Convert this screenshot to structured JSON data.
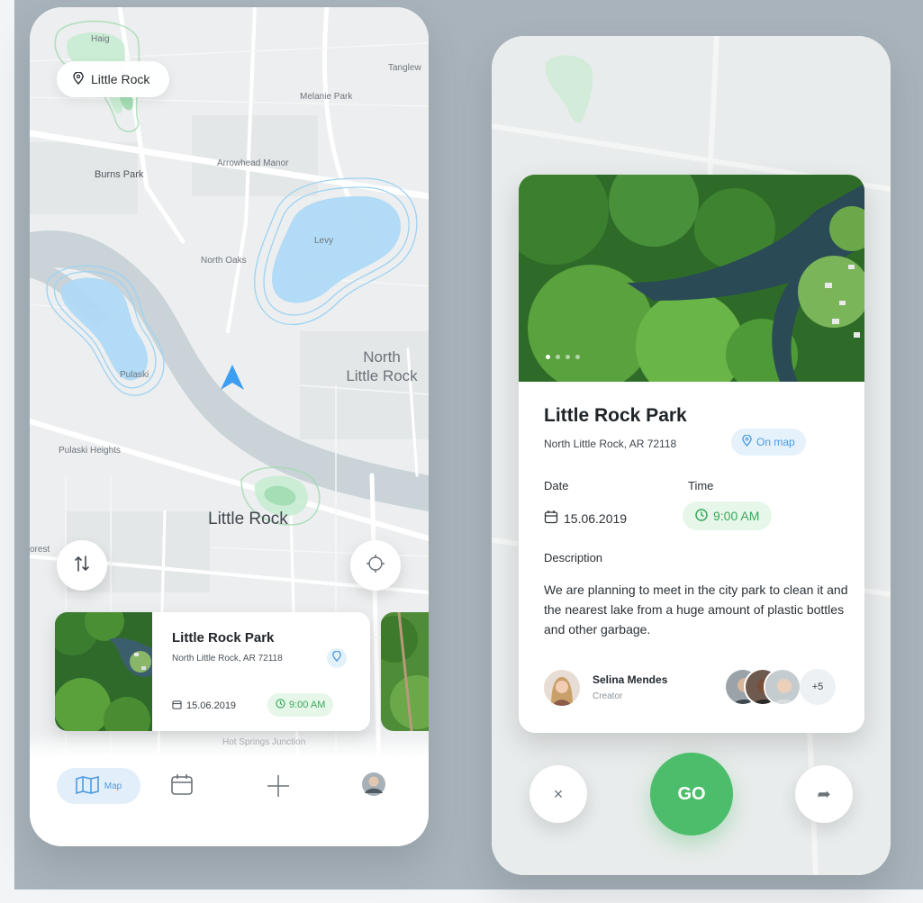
{
  "colors": {
    "accent_blue": "#4d9be0",
    "accent_green": "#4cbd6a",
    "time_green": "#3aa85a"
  },
  "map": {
    "location_chip": "Little Rock",
    "labels": {
      "haig": "Haig",
      "tanglewood": "Tanglew",
      "melanie_park": "Melanie Park",
      "burns_park": "Burns Park",
      "arrowhead_manor": "Arrowhead Manor",
      "levy": "Levy",
      "north_oaks": "North Oaks",
      "north_little_rock_1": "North",
      "north_little_rock_2": "Little Rock",
      "pulaski": "Pulaski",
      "pulaski_heights": "Pulaski Heights",
      "little_rock": "Little Rock",
      "forest": "orest",
      "hot_springs": "Hot Springs Junction"
    }
  },
  "event_card": {
    "title": "Little Rock Park",
    "address": "North Little Rock, AR 72118",
    "date": "15.06.2019",
    "time": "9:00 AM"
  },
  "bottom_nav": {
    "map_label": "Map"
  },
  "detail": {
    "title": "Little Rock Park",
    "address": "North Little Rock, AR 72118",
    "on_map_label": "On map",
    "date_label": "Date",
    "time_label": "Time",
    "date": "15.06.2019",
    "time": "9:00 AM",
    "description_label": "Description",
    "description": "We are planning to meet in the city park to clean it and the nearest lake from a huge amount of plastic bottles and other garbage.",
    "creator_name": "Selina Mendes",
    "creator_role": "Creator",
    "more_count": "+5",
    "go_label": "GO",
    "close_glyph": "×",
    "share_glyph": "➦"
  }
}
